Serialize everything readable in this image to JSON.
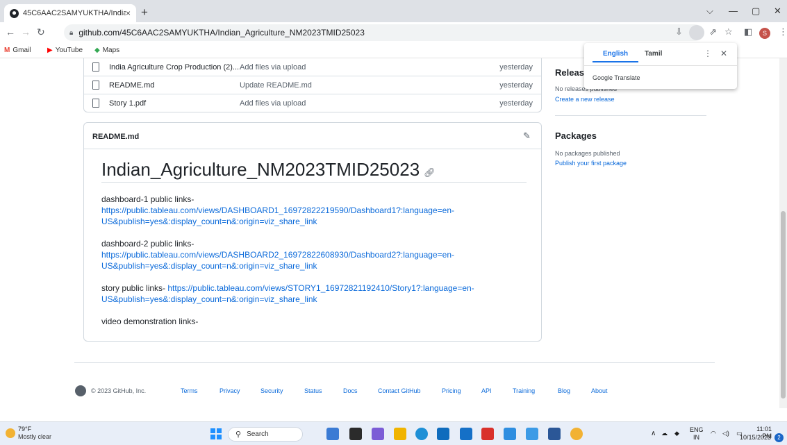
{
  "browser": {
    "tab_title": "45C6AAC2SAMYUKTHA/Indian_",
    "tab_close": "×",
    "new_tab": "+",
    "url": "github.com/45C6AAC2SAMYUKTHA/Indian_Agriculture_NM2023TMID25023",
    "window_controls": {
      "dropdown": "⌵",
      "minimize": "—",
      "maximize": "▢",
      "close": "✕"
    },
    "profile_initial": "S",
    "bookmarks": [
      {
        "label": "Gmail",
        "icon": "gmail-icon",
        "color": "#ea4335"
      },
      {
        "label": "YouTube",
        "icon": "youtube-icon",
        "color": "#ff0000"
      },
      {
        "label": "Maps",
        "icon": "maps-icon",
        "color": "#34a853"
      }
    ]
  },
  "files": [
    {
      "name": "India Agriculture Crop Production (2)....",
      "message": "Add files via upload",
      "date": "yesterday"
    },
    {
      "name": "README.md",
      "message": "Update README.md",
      "date": "yesterday"
    },
    {
      "name": "Story 1.pdf",
      "message": "Add files via upload",
      "date": "yesterday"
    }
  ],
  "readme": {
    "header": "README.md",
    "title": "Indian_Agriculture_NM2023TMID25023",
    "paragraphs": [
      {
        "label": "dashboard-1 public links-",
        "link": "https://public.tableau.com/views/DASHBOARD1_16972822219590/Dashboard1?:language=en-US&publish=yes&:display_count=n&:origin=viz_share_link"
      },
      {
        "label": "dashboard-2 public links-",
        "link": "https://public.tableau.com/views/DASHBOARD2_16972822608930/Dashboard2?:language=en-US&publish=yes&:display_count=n&:origin=viz_share_link"
      },
      {
        "label": "story public links-",
        "link": "https://public.tableau.com/views/STORY1_16972821192410/Story1?:language=en-US&publish=yes&:display_count=n&:origin=viz_share_link"
      },
      {
        "label": "video demonstration links-",
        "link": ""
      }
    ]
  },
  "sidebar": {
    "releases_heading": "Releases",
    "releases_text": "No releases published",
    "releases_link": "Create a new release",
    "packages_heading": "Packages",
    "packages_text": "No packages published",
    "packages_link": "Publish your first package"
  },
  "translate_popup": {
    "lang_source": "English",
    "lang_target": "Tamil",
    "brand": "Google Translate"
  },
  "footer": {
    "copyright": "© 2023 GitHub, Inc.",
    "links": [
      "Terms",
      "Privacy",
      "Security",
      "Status",
      "Docs",
      "Contact GitHub",
      "Pricing",
      "API",
      "Training",
      "Blog",
      "About"
    ]
  },
  "taskbar": {
    "weather_temp": "79°F",
    "weather_desc": "Mostly clear",
    "search_placeholder": "Search",
    "lang_primary": "ENG",
    "lang_secondary": "IN",
    "time": "11:01 PM",
    "date": "10/15/2023",
    "notification_count": "2"
  },
  "colors": {
    "link": "#0969da",
    "border": "#d0d7de",
    "muted": "#57606a",
    "translate_accent": "#1a73e8"
  }
}
